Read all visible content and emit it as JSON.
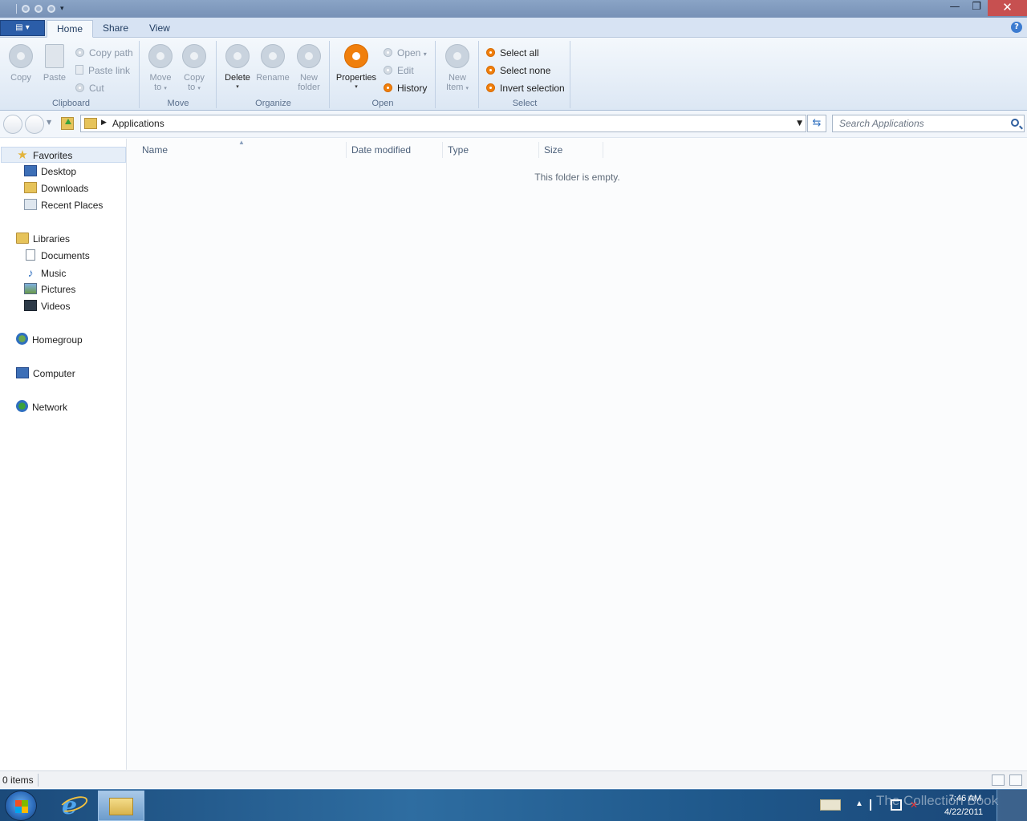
{
  "window": {
    "close_glyph": "✕",
    "maximize_glyph": "❐",
    "minimize_glyph": "—"
  },
  "ribbon": {
    "file_glyph": "▤ ▾",
    "tabs": [
      {
        "label": "Home",
        "active": true
      },
      {
        "label": "Share",
        "active": false
      },
      {
        "label": "View",
        "active": false
      }
    ],
    "help_glyph": "?",
    "groups": {
      "clipboard": {
        "label": "Clipboard",
        "copy": "Copy",
        "paste": "Paste",
        "copy_path": "Copy path",
        "paste_link": "Paste link",
        "cut": "Cut"
      },
      "move": {
        "label": "Move",
        "move_to_1": "Move",
        "move_to_2": "to",
        "copy_to_1": "Copy",
        "copy_to_2": "to"
      },
      "organize": {
        "label": "Organize",
        "delete": "Delete",
        "rename": "Rename",
        "new_folder_1": "New",
        "new_folder_2": "folder"
      },
      "open": {
        "label": "Open",
        "properties": "Properties",
        "open": "Open",
        "edit": "Edit",
        "history": "History"
      },
      "new": {
        "new_item_1": "New",
        "new_item_2": "Item"
      },
      "select": {
        "label": "Select",
        "select_all": "Select all",
        "select_none": "Select none",
        "invert_selection": "Invert selection"
      }
    }
  },
  "address": {
    "path": "Applications",
    "refresh_glyph": "⇆",
    "search_placeholder": "Search Applications"
  },
  "nav": {
    "favorites": "Favorites",
    "desktop": "Desktop",
    "downloads": "Downloads",
    "recent_places": "Recent Places",
    "libraries": "Libraries",
    "documents": "Documents",
    "music": "Music",
    "pictures": "Pictures",
    "videos": "Videos",
    "homegroup": "Homegroup",
    "computer": "Computer",
    "network": "Network"
  },
  "content": {
    "columns": [
      "Name",
      "Date modified",
      "Type",
      "Size"
    ],
    "sort_glyph": "▲",
    "empty_message": "This folder is empty."
  },
  "status": {
    "item_count": "0 items"
  },
  "taskbar": {
    "time": "7:46 AM",
    "date": "4/22/2011",
    "watermark": "The Collection Book"
  }
}
